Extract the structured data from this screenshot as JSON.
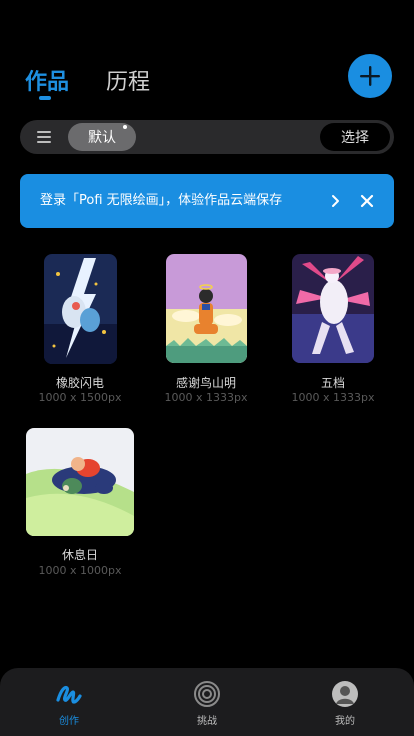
{
  "header": {
    "tabs": [
      "作品",
      "历程"
    ]
  },
  "filter": {
    "default_label": "默认",
    "select_label": "选择"
  },
  "banner": {
    "text": "登录「Pofi 无限绘画」，体验作品云端保存"
  },
  "artworks": [
    {
      "title": "橡胶闪电",
      "size": "1000 x 1500px"
    },
    {
      "title": "感谢鸟山明",
      "size": "1000 x 1333px"
    },
    {
      "title": "五档",
      "size": "1000 x 1333px"
    },
    {
      "title": "休息日",
      "size": "1000 x 1000px"
    }
  ],
  "nav": {
    "items": [
      {
        "label": "创作"
      },
      {
        "label": "挑战"
      },
      {
        "label": "我的"
      }
    ]
  },
  "colors": {
    "accent": "#1a8ee1",
    "background": "#000000",
    "nav_bg": "#1c1c1e"
  }
}
